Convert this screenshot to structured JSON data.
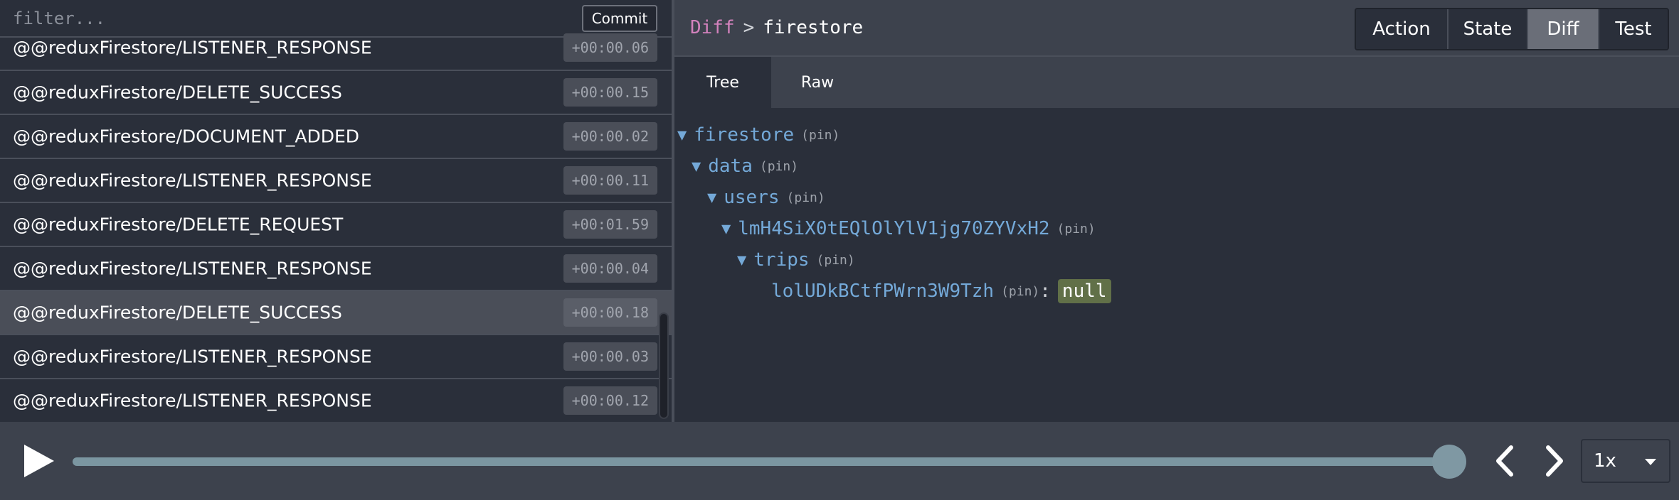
{
  "filter": {
    "placeholder": "filter...",
    "value": ""
  },
  "commit_label": "Commit",
  "actions": [
    {
      "name": "@@reduxFirestore/LISTENER_RESPONSE",
      "time": "+00:00.06"
    },
    {
      "name": "@@reduxFirestore/DELETE_SUCCESS",
      "time": "+00:00.15"
    },
    {
      "name": "@@reduxFirestore/DOCUMENT_ADDED",
      "time": "+00:00.02"
    },
    {
      "name": "@@reduxFirestore/LISTENER_RESPONSE",
      "time": "+00:00.11"
    },
    {
      "name": "@@reduxFirestore/DELETE_REQUEST",
      "time": "+00:01.59"
    },
    {
      "name": "@@reduxFirestore/LISTENER_RESPONSE",
      "time": "+00:00.04"
    },
    {
      "name": "@@reduxFirestore/DELETE_SUCCESS",
      "time": "+00:00.18"
    },
    {
      "name": "@@reduxFirestore/LISTENER_RESPONSE",
      "time": "+00:00.03"
    },
    {
      "name": "@@reduxFirestore/LISTENER_RESPONSE",
      "time": "+00:00.12"
    }
  ],
  "breadcrumb": {
    "root": "Diff",
    "separator": ">",
    "current": "firestore"
  },
  "mode_tabs": [
    "Action",
    "State",
    "Diff",
    "Test"
  ],
  "active_mode": "Diff",
  "subtabs": [
    "Tree",
    "Raw"
  ],
  "active_subtab": "Tree",
  "tree": {
    "pin_label": "(pin)",
    "arrow": "▼",
    "nodes": [
      "firestore",
      "data",
      "users",
      "lmH4SiX0tEQlOlYlV1jg70ZYVxH2",
      "trips"
    ],
    "leaf": {
      "key": "lolUDkBCtfPWrn3W9Tzh",
      "colon": ":",
      "value": "null"
    }
  },
  "playback": {
    "speed": "1x",
    "progress": 1.0
  },
  "colors": {
    "accent_pink": "#d382bd",
    "tree_key": "#74a9d8",
    "null_bg": "#617048",
    "selected_row": "#4a4e58"
  }
}
